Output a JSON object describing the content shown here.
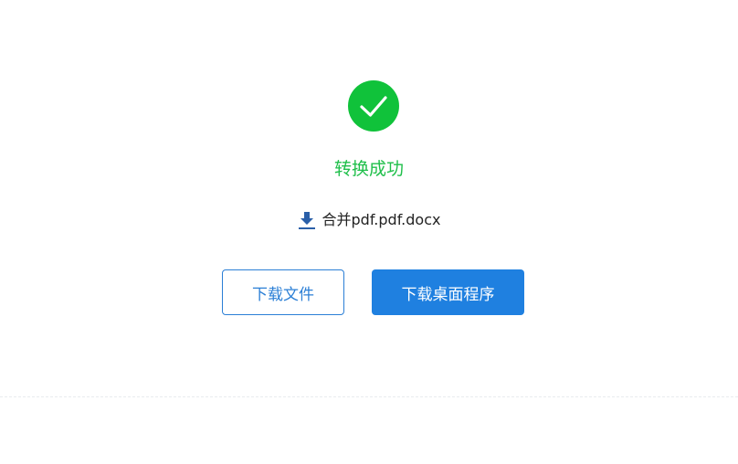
{
  "result": {
    "status_text": "转换成功",
    "file_name": "合并pdf.pdf.docx"
  },
  "icons": {
    "success": "check-circle-icon",
    "download": "download-icon"
  },
  "buttons": {
    "download_file_label": "下载文件",
    "download_desktop_label": "下载桌面程序"
  },
  "colors": {
    "success": "#10c23a",
    "status_text": "#1fbf4a",
    "primary": "#1f80e0",
    "outline": "#2b7fd6",
    "download_icon": "#2a5fa8"
  }
}
